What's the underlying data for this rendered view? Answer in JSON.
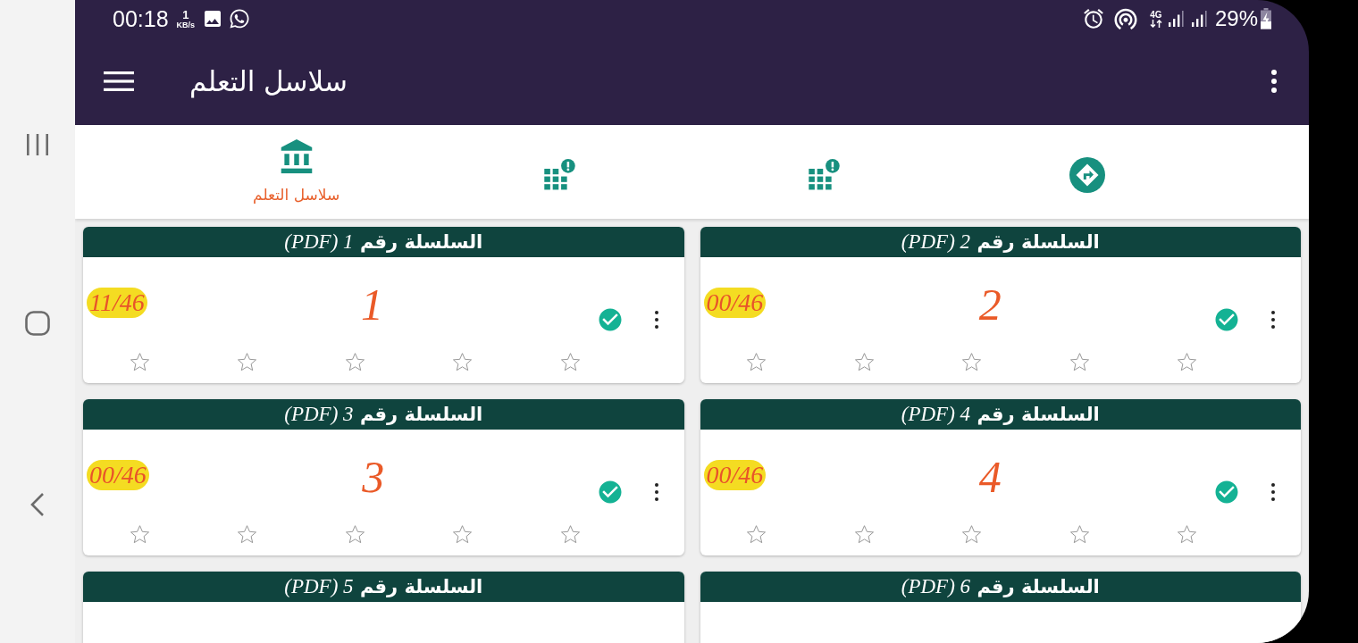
{
  "status_bar": {
    "time": "00:18",
    "net_speed": "1",
    "net_unit": "KB/s",
    "network": "4G",
    "battery": "29%"
  },
  "app_bar": {
    "title": "سلاسل التعلم"
  },
  "tabs": [
    {
      "label": "سلاسل التعلم",
      "selected": true
    },
    {
      "selected": false
    },
    {
      "selected": false
    },
    {
      "selected": false
    }
  ],
  "cards": [
    {
      "title": "السلسلة رقم *2 (PDF)*",
      "count": "00/46",
      "number": "2",
      "checked": true,
      "stars": 0
    },
    {
      "title": "السلسلة رقم *1 (PDF)*",
      "count": "11/46",
      "number": "1",
      "checked": true,
      "stars": 0
    },
    {
      "title": "السلسلة رقم *4 (PDF)*",
      "count": "00/46",
      "number": "4",
      "checked": true,
      "stars": 0
    },
    {
      "title": "السلسلة رقم *3 (PDF)*",
      "count": "00/46",
      "number": "3",
      "checked": true,
      "stars": 0
    },
    {
      "title": "السلسلة رقم *6 (PDF)*"
    },
    {
      "title": "السلسلة رقم *5 (PDF)*"
    }
  ]
}
